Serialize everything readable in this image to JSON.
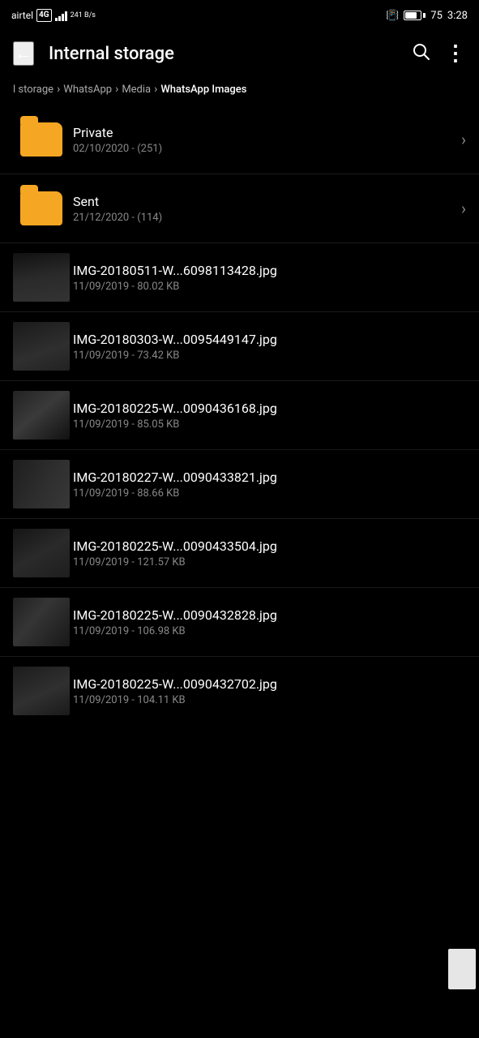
{
  "statusBar": {
    "carrier": "airtel",
    "networkType": "4G",
    "dataSpeed": "241\nB/s",
    "batteryPercent": "75",
    "time": "3:28"
  },
  "appBar": {
    "backLabel": "←",
    "title": "Internal storage",
    "searchLabel": "🔍",
    "moreLabel": "⋮"
  },
  "breadcrumb": {
    "items": [
      {
        "label": "l storage",
        "active": false
      },
      {
        "label": "WhatsApp",
        "active": false
      },
      {
        "label": "Media",
        "active": false
      },
      {
        "label": "WhatsApp Images",
        "active": true
      }
    ]
  },
  "folders": [
    {
      "name": "Private",
      "meta": "02/10/2020 - (251)"
    },
    {
      "name": "Sent",
      "meta": "21/12/2020 - (114)"
    }
  ],
  "files": [
    {
      "name": "IMG-20180511-W...6098113428.jpg",
      "meta": "11/09/2019 - 80.02 KB",
      "thumbClass": "thumb-1"
    },
    {
      "name": "IMG-20180303-W...0095449147.jpg",
      "meta": "11/09/2019 - 73.42 KB",
      "thumbClass": "thumb-2"
    },
    {
      "name": "IMG-20180225-W...0090436168.jpg",
      "meta": "11/09/2019 - 85.05 KB",
      "thumbClass": "thumb-3"
    },
    {
      "name": "IMG-20180227-W...0090433821.jpg",
      "meta": "11/09/2019 - 88.66 KB",
      "thumbClass": "thumb-4"
    },
    {
      "name": "IMG-20180225-W...0090433504.jpg",
      "meta": "11/09/2019 - 121.57 KB",
      "thumbClass": "thumb-5"
    },
    {
      "name": "IMG-20180225-W...0090432828.jpg",
      "meta": "11/09/2019 - 106.98 KB",
      "thumbClass": "thumb-6"
    },
    {
      "name": "IMG-20180225-W...0090432702.jpg",
      "meta": "11/09/2019 - 104.11 KB",
      "thumbClass": "thumb-7"
    }
  ]
}
